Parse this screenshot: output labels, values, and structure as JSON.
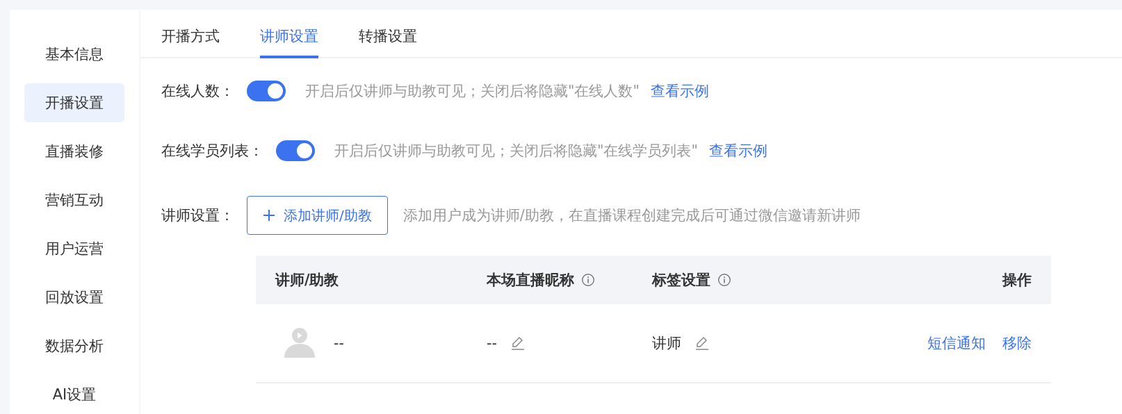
{
  "sidebar": {
    "items": [
      {
        "label": "基本信息",
        "selected": false
      },
      {
        "label": "开播设置",
        "selected": true
      },
      {
        "label": "直播装修",
        "selected": false
      },
      {
        "label": "营销互动",
        "selected": false
      },
      {
        "label": "用户运营",
        "selected": false
      },
      {
        "label": "回放设置",
        "selected": false
      },
      {
        "label": "数据分析",
        "selected": false
      },
      {
        "label": "AI设置",
        "selected": false
      }
    ]
  },
  "tabs": [
    {
      "label": "开播方式",
      "selected": false
    },
    {
      "label": "讲师设置",
      "selected": true
    },
    {
      "label": "转播设置",
      "selected": false
    }
  ],
  "settings": [
    {
      "label": "在线人数：",
      "on": true,
      "hint": "开启后仅讲师与助教可见；关闭后将隐藏\"在线人数\"",
      "link": "查看示例"
    },
    {
      "label": "在线学员列表：",
      "on": true,
      "hint": "开启后仅讲师与助教可见；关闭后将隐藏\"在线学员列表\"",
      "link": "查看示例"
    }
  ],
  "teacher_setting": {
    "label": "讲师设置：",
    "button": "添加讲师/助教",
    "hint": "添加用户成为讲师/助教，在直播课程创建完成后可通过微信邀请新讲师"
  },
  "table": {
    "columns": [
      {
        "label": "讲师/助教",
        "info": false
      },
      {
        "label": "本场直播昵称",
        "info": true
      },
      {
        "label": "标签设置",
        "info": true
      },
      {
        "label": "操作",
        "info": false
      }
    ],
    "rows": [
      {
        "name": "--",
        "nickname": "--",
        "tag": "讲师",
        "actions": [
          "短信通知",
          "移除"
        ]
      }
    ]
  }
}
